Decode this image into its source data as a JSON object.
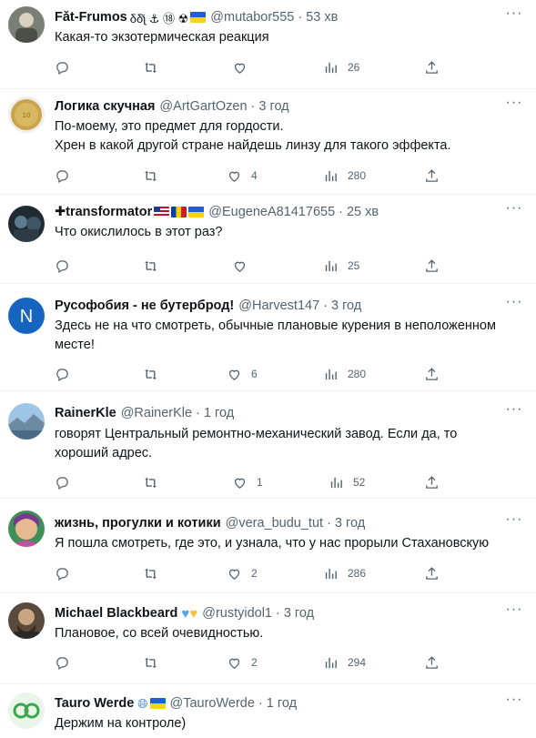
{
  "tweets": [
    {
      "name": "Fǎt-Frumos",
      "emoji": "δδ̌ʅ ⚓ ⑱ ☢",
      "handle": "@mutabor555",
      "time": "53 хв",
      "lines": [
        "Какая-то экзотермическая реакция"
      ],
      "likes": "",
      "views": "26"
    },
    {
      "name": "Логика скучная",
      "emoji": "",
      "handle": "@ArtGartOzen",
      "time": "3 год",
      "lines": [
        "По-моему, это предмет для гордости.",
        "Хрен в какой другой стране найдешь линзу для такого эффекта."
      ],
      "likes": "4",
      "views": "280"
    },
    {
      "name": "✚transformator",
      "emoji": "",
      "handle": "@EugeneA81417655",
      "time": "25 хв",
      "lines": [
        "Что окислилось в этот раз?"
      ],
      "likes": "",
      "views": "25"
    },
    {
      "name": "Русофобия - не бутерброд!",
      "emoji": "",
      "handle": "@Harvest147",
      "time": "3 год",
      "lines": [
        "Здесь не на что смотреть, обычные плановые курения в неположенном",
        "месте!"
      ],
      "likes": "6",
      "views": "280"
    },
    {
      "name": "RainerKle",
      "emoji": "",
      "handle": "@RainerKle",
      "time": "1 год",
      "lines": [
        "говорят Центральный ремонтно-механический завод. Если да, то",
        "хороший адрес."
      ],
      "likes": "1",
      "views": "52"
    },
    {
      "name": "жизнь, прогулки и котики",
      "emoji": "",
      "handle": "@vera_budu_tut",
      "time": "3 год",
      "lines": [
        "Я пошла смотреть, где это, и узнала, что у нас прорыли Стахановскую"
      ],
      "likes": "2",
      "views": "286"
    },
    {
      "name": "Michael Blackbeard",
      "emoji": "",
      "handle": "@rustyidol1",
      "time": "3 год",
      "lines": [
        "Плановое, со всей очевидностью."
      ],
      "likes": "2",
      "views": "294"
    },
    {
      "name": "Tauro Werde",
      "emoji": "",
      "handle": "@TauroWerde",
      "time": "1 год",
      "lines": [
        "Держим на контроле)"
      ],
      "likes": "",
      "views": ""
    }
  ],
  "colors": {
    "text": "#0f1419",
    "muted": "#536471",
    "divider": "#eff3f4"
  },
  "icons": [
    "reply-icon",
    "retweet-icon",
    "like-icon",
    "views-icon",
    "share-icon",
    "more-icon"
  ]
}
